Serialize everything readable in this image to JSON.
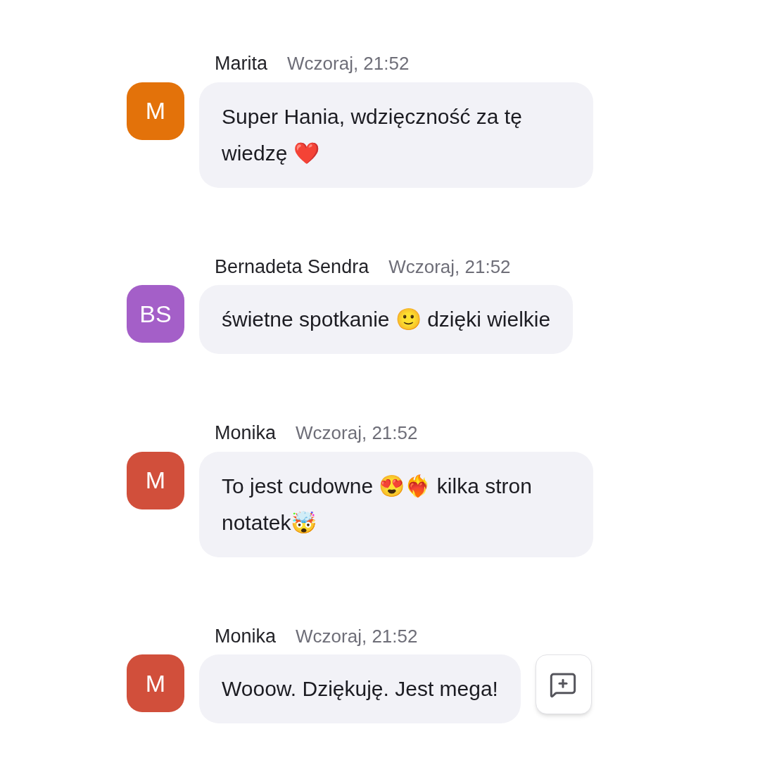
{
  "messages": [
    {
      "author": "Marita",
      "initials": "M",
      "color": "#e3720a",
      "time": "Wczoraj, 21:52",
      "text": "Super Hania, wdzięczność za tę wiedzę ❤️",
      "hovered": false
    },
    {
      "author": "Bernadeta Sendra",
      "initials": "BS",
      "color": "#a45fc8",
      "time": "Wczoraj, 21:52",
      "text": "świetne spotkanie 🙂 dzięki wielkie",
      "hovered": false
    },
    {
      "author": "Monika",
      "initials": "M",
      "color": "#d14f3b",
      "time": "Wczoraj, 21:52",
      "text": "To jest cudowne 😍❤️‍🔥 kilka stron notatek🤯",
      "hovered": false
    },
    {
      "author": "Monika",
      "initials": "M",
      "color": "#d14f3b",
      "time": "Wczoraj, 21:52",
      "text": "Wooow. Dziękuję. Jest mega!",
      "hovered": true
    }
  ]
}
